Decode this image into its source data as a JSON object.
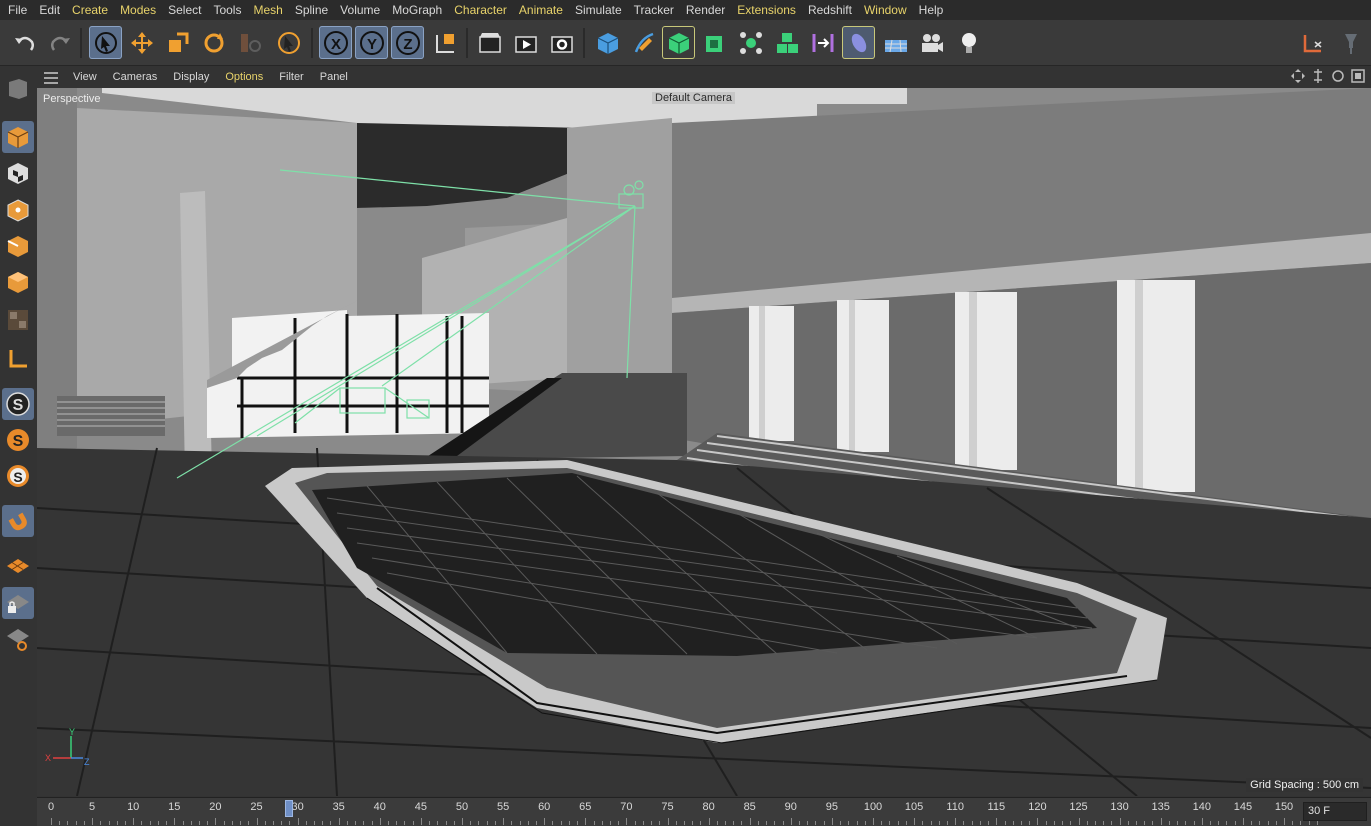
{
  "menu": {
    "items": [
      {
        "label": "File"
      },
      {
        "label": "Edit"
      },
      {
        "label": "Create",
        "hl": true
      },
      {
        "label": "Modes",
        "hl": true
      },
      {
        "label": "Select"
      },
      {
        "label": "Tools"
      },
      {
        "label": "Mesh",
        "hl": true
      },
      {
        "label": "Spline"
      },
      {
        "label": "Volume"
      },
      {
        "label": "MoGraph"
      },
      {
        "label": "Character",
        "hl": true
      },
      {
        "label": "Animate",
        "hl": true
      },
      {
        "label": "Simulate"
      },
      {
        "label": "Tracker"
      },
      {
        "label": "Render"
      },
      {
        "label": "Extensions",
        "hl": true
      },
      {
        "label": "Redshift"
      },
      {
        "label": "Window",
        "hl": true
      },
      {
        "label": "Help"
      }
    ]
  },
  "toolbar": {
    "icons": [
      "undo-icon",
      "redo-icon",
      "live-selection-icon",
      "move-icon",
      "scale-icon",
      "rotate-icon",
      "recent-tools-icon",
      "select-icon",
      "x-axis-lock-icon",
      "y-axis-lock-icon",
      "z-axis-lock-icon",
      "coordinate-system-icon",
      "render-view-icon",
      "render-picture-viewer-icon",
      "render-settings-icon",
      "cube-icon",
      "pen-icon",
      "subdivision-icon",
      "extrude-icon",
      "cloner-icon",
      "mograph-fracture-icon",
      "symmetry-icon",
      "deformer-icon",
      "floor-icon",
      "camera-icon",
      "light-icon",
      "workplane-icon",
      "pin-icon"
    ]
  },
  "viewport_menu": {
    "items": [
      {
        "label": "View"
      },
      {
        "label": "Cameras"
      },
      {
        "label": "Display"
      },
      {
        "label": "Options",
        "hl": true
      },
      {
        "label": "Filter"
      },
      {
        "label": "Panel"
      }
    ]
  },
  "viewport": {
    "name": "Perspective",
    "camera": "Default Camera",
    "grid_spacing": "Grid Spacing : 500 cm",
    "axes": {
      "x": "X",
      "y": "Y",
      "z": "Z"
    }
  },
  "timeline": {
    "ticks": [
      "0",
      "5",
      "10",
      "15",
      "20",
      "25",
      "30",
      "35",
      "40",
      "45",
      "50",
      "55",
      "60",
      "65",
      "70",
      "75",
      "80",
      "85",
      "90",
      "95",
      "100",
      "105",
      "110",
      "115",
      "120",
      "125",
      "130",
      "135",
      "140",
      "145",
      "150"
    ],
    "current_frame": 29,
    "end_frame_label": "30 F"
  },
  "colors": {
    "accent": "#5b6f8c",
    "menu_highlight": "#e8d36a",
    "camera_wire": "#7ee0a8"
  }
}
